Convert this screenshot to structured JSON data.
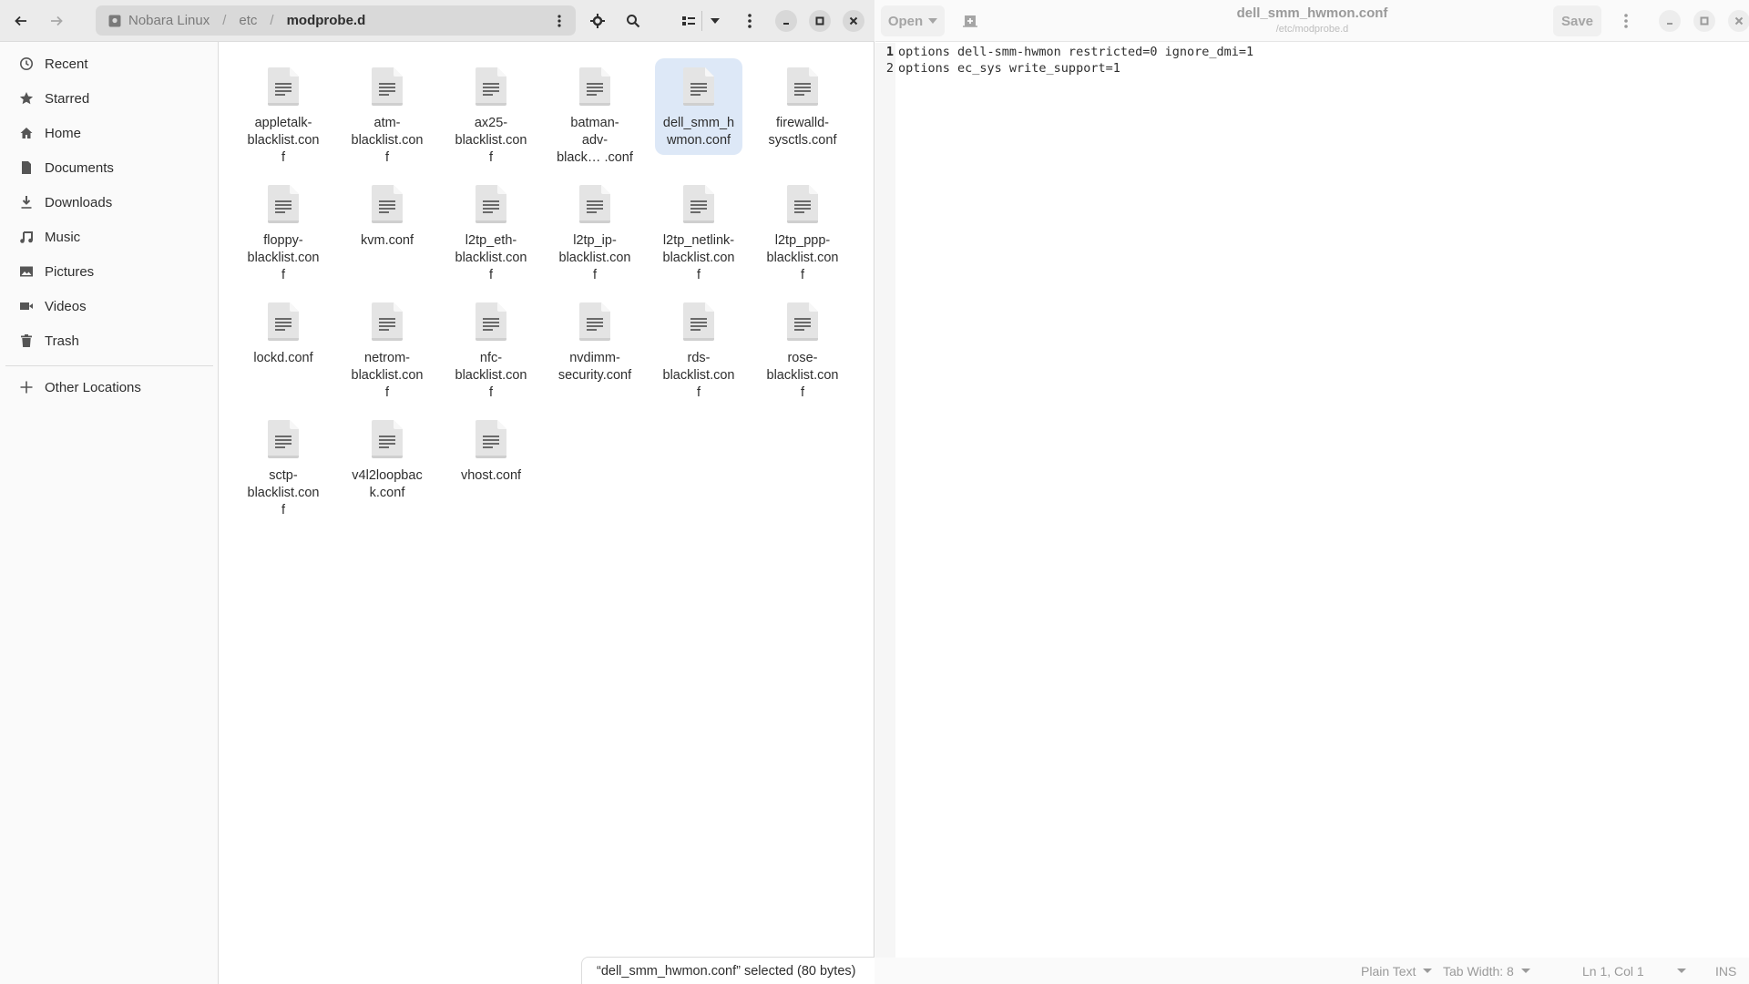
{
  "files": {
    "nav": {
      "back_icon": "arrow-left-icon",
      "forward_icon": "arrow-right-icon"
    },
    "location": {
      "drive_icon": "drive-icon",
      "crumbs": [
        "Nobara Linux",
        "etc",
        "modprobe.d"
      ],
      "separator": "/"
    },
    "toolbar": {
      "locate_icon": "crosshair-icon",
      "search_icon": "search-icon",
      "view_icon": "list-view-icon",
      "view_dropdown_icon": "chevron-down-icon",
      "menu_icon": "kebab-menu-icon"
    },
    "sidebar": {
      "items": [
        {
          "label": "Recent",
          "icon": "clock-icon"
        },
        {
          "label": "Starred",
          "icon": "star-icon"
        },
        {
          "label": "Home",
          "icon": "home-icon"
        },
        {
          "label": "Documents",
          "icon": "document-icon"
        },
        {
          "label": "Downloads",
          "icon": "download-icon"
        },
        {
          "label": "Music",
          "icon": "music-icon"
        },
        {
          "label": "Pictures",
          "icon": "image-icon"
        },
        {
          "label": "Videos",
          "icon": "video-icon"
        },
        {
          "label": "Trash",
          "icon": "trash-icon"
        }
      ],
      "other": {
        "label": "Other Locations",
        "icon": "plus-icon"
      }
    },
    "grid": {
      "items": [
        {
          "name": "appletalk-blacklist.conf",
          "display": "appletalk-\nblacklist.con\nf"
        },
        {
          "name": "atm-blacklist.conf",
          "display": "atm-\nblacklist.con\nf"
        },
        {
          "name": "ax25-blacklist.conf",
          "display": "ax25-\nblacklist.con\nf"
        },
        {
          "name": "batman-adv-blacklist.conf",
          "display": "batman-\nadv-\nblack… .conf"
        },
        {
          "name": "dell_smm_hwmon.conf",
          "display": "dell_smm_h\nwmon.conf",
          "selected": true
        },
        {
          "name": "firewalld-sysctls.conf",
          "display": "firewalld-\nsysctls.conf"
        },
        {
          "name": "floppy-blacklist.conf",
          "display": "floppy-\nblacklist.con\nf"
        },
        {
          "name": "kvm.conf",
          "display": "kvm.conf"
        },
        {
          "name": "l2tp_eth-blacklist.conf",
          "display": "l2tp_eth-\nblacklist.con\nf"
        },
        {
          "name": "l2tp_ip-blacklist.conf",
          "display": "l2tp_ip-\nblacklist.con\nf"
        },
        {
          "name": "l2tp_netlink-blacklist.conf",
          "display": "l2tp_netlink-\nblacklist.con\nf"
        },
        {
          "name": "l2tp_ppp-blacklist.conf",
          "display": "l2tp_ppp-\nblacklist.con\nf"
        },
        {
          "name": "lockd.conf",
          "display": "lockd.conf"
        },
        {
          "name": "netrom-blacklist.conf",
          "display": "netrom-\nblacklist.con\nf"
        },
        {
          "name": "nfc-blacklist.conf",
          "display": "nfc-\nblacklist.con\nf"
        },
        {
          "name": "nvdimm-security.conf",
          "display": "nvdimm-\nsecurity.conf"
        },
        {
          "name": "rds-blacklist.conf",
          "display": "rds-\nblacklist.con\nf"
        },
        {
          "name": "rose-blacklist.conf",
          "display": "rose-\nblacklist.con\nf"
        },
        {
          "name": "sctp-blacklist.conf",
          "display": "sctp-\nblacklist.con\nf"
        },
        {
          "name": "v4l2loopback.conf",
          "display": "v4l2loopbac\nk.conf"
        },
        {
          "name": "vhost.conf",
          "display": "vhost.conf"
        }
      ]
    },
    "status": "“dell_smm_hwmon.conf” selected  (80 bytes)"
  },
  "editor": {
    "open_label": "Open",
    "title": "dell_smm_hwmon.conf",
    "subtitle": "/etc/modprobe.d",
    "save_label": "Save",
    "lines": [
      {
        "num": "1",
        "text": "options dell-smm-hwmon restricted=0 ignore_dmi=1"
      },
      {
        "num": "2",
        "text": "options ec_sys write_support=1"
      }
    ],
    "statusbar": {
      "language": "Plain Text",
      "tab_width": "Tab Width: 8",
      "cursor": "Ln 1, Col 1",
      "mode": "INS"
    }
  },
  "colors": {
    "selection": "#dde8f7",
    "header_bg": "#ebebeb",
    "sidebar_bg": "#fafafa"
  }
}
